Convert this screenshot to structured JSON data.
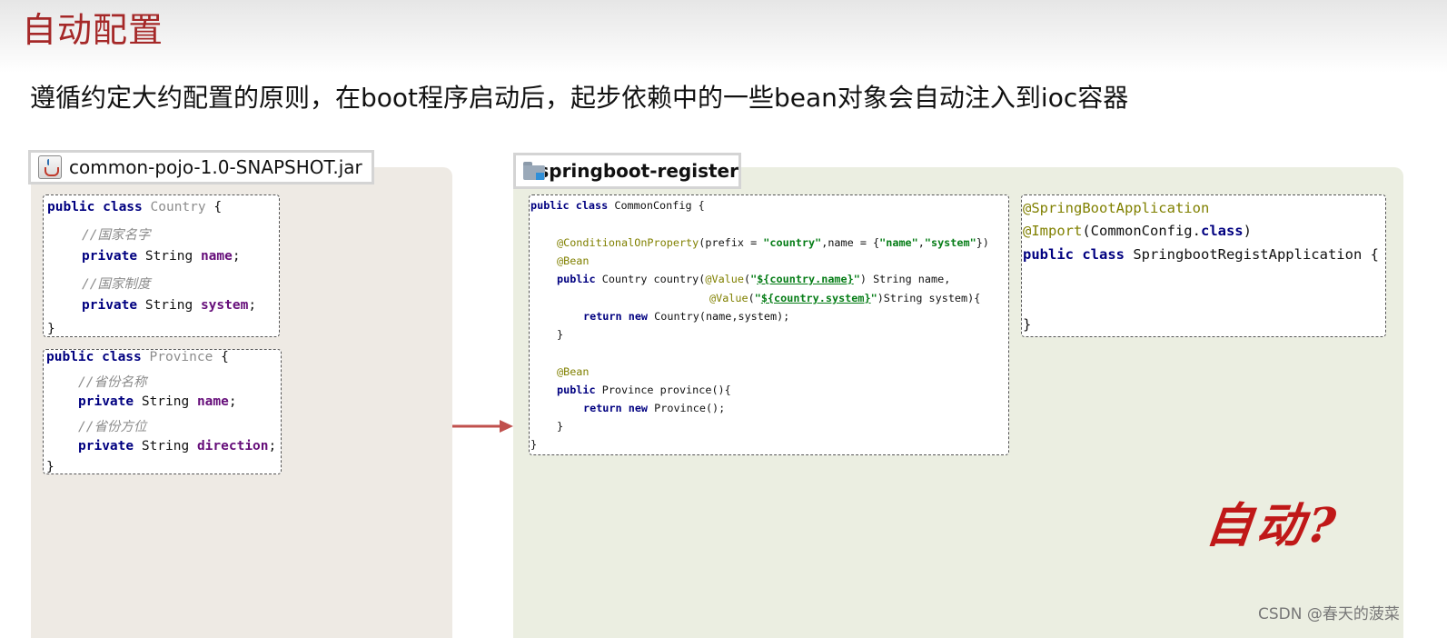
{
  "title": "自动配置",
  "subtitle": "遵循约定大约配置的原则，在boot程序启动后，起步依赖中的一些bean对象会自动注入到ioc容器",
  "left_panel": {
    "label": "common-pojo-1.0-SNAPSHOT.jar",
    "icon": "jar-file-icon",
    "country_code": {
      "l1_kw": "public class ",
      "l1_name": "Country",
      "l1_end": " {",
      "l2": "//国家名字",
      "l3_kw": "private ",
      "l3_type": "String ",
      "l3_field": "name",
      "l3_end": ";",
      "l4": "//国家制度",
      "l5_kw": "private ",
      "l5_type": "String ",
      "l5_field": "system",
      "l5_end": ";",
      "l6": "}"
    },
    "province_code": {
      "l1_kw": "public class ",
      "l1_name": "Province",
      "l1_end": " {",
      "l2": "//省份名称",
      "l3_kw": "private ",
      "l3_type": "String ",
      "l3_field": "name",
      "l3_end": ";",
      "l4": "//省份方位",
      "l5_kw": "private ",
      "l5_type": "String ",
      "l5_field": "direction",
      "l5_end": ";",
      "l6": "}"
    }
  },
  "right_panel": {
    "label": "springboot-register",
    "icon": "folder-module-icon",
    "common_config": {
      "l1_kw": "public class ",
      "l1_rest": "CommonConfig {",
      "l3_ann": "@ConditionalOnProperty",
      "l3_a": "(prefix = ",
      "l3_s1": "\"country\"",
      "l3_b": ",name = {",
      "l3_s2": "\"name\"",
      "l3_c": ",",
      "l3_s3": "\"system\"",
      "l3_d": "})",
      "l4_ann": "@Bean",
      "l5_kw": "public ",
      "l5_a": "Country country(",
      "l5_ann": "@Value",
      "l5_b": "(",
      "l5_q1": "\"",
      "l5_ref": "${country.name}",
      "l5_q2": "\"",
      "l5_c": ") String name,",
      "l6_ann": "@Value",
      "l6_b": "(",
      "l6_q1": "\"",
      "l6_ref": "${country.system}",
      "l6_q2": "\"",
      "l6_c": ")String system){",
      "l7_kw": "return new ",
      "l7_rest": "Country(name,system);",
      "l8": "}",
      "l10_ann": "@Bean",
      "l11_kw": "public ",
      "l11_rest": "Province province(){",
      "l12_kw": "return new ",
      "l12_rest": "Province();",
      "l13": "}",
      "l14": "}"
    },
    "app_code": {
      "l1": "@SpringBootApplication",
      "l2_ann": "@Import",
      "l2_a": "(CommonConfig.",
      "l2_kw": "class",
      "l2_b": ")",
      "l3_kw": "public class ",
      "l3_rest": "SpringbootRegistApplication {",
      "l4": "}"
    }
  },
  "overlay_text": "自动?",
  "watermark": "CSDN @春天的菠菜",
  "colors": {
    "title": "#a52828",
    "left_panel_bg": "#eeeae4",
    "right_panel_bg": "#ebeee1",
    "arrow": "#c0504d",
    "overlay": "#c01818"
  }
}
